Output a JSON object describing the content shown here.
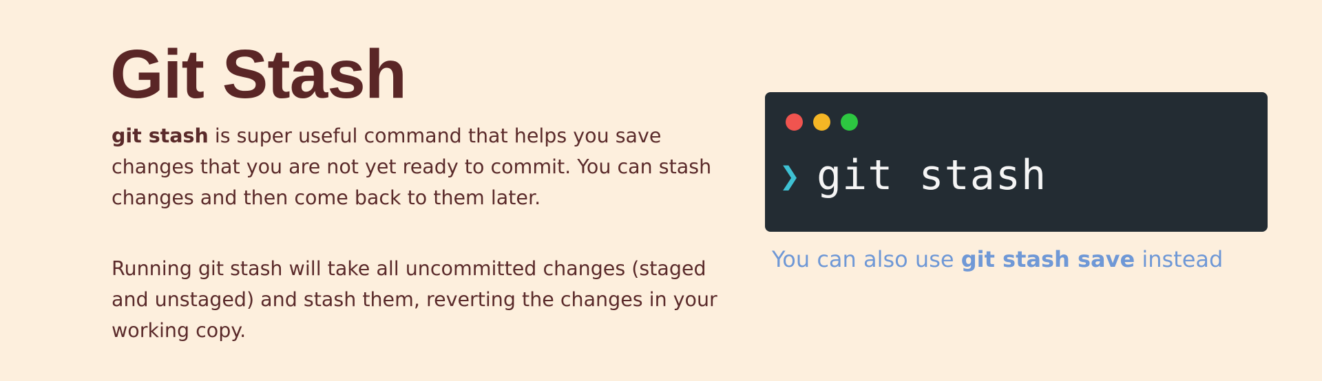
{
  "slide": {
    "title": "Git Stash",
    "paragraph1": {
      "bold": "git stash",
      "text": " is super useful command that helps you save changes that you are not yet ready to commit.  You can stash changes and then come back to them later."
    },
    "paragraph2": "Running git stash will take all uncommitted changes (staged and unstaged) and stash them, reverting the changes in your working copy.",
    "terminal": {
      "prompt_symbol": "❯",
      "command": "git stash"
    },
    "note": {
      "before": "You can also use ",
      "bold": "git stash save",
      "after": " instead"
    }
  },
  "colors": {
    "background": "#fdefdd",
    "title": "#5a2626",
    "body_text": "#5a2a2a",
    "terminal_bg": "#232c33",
    "prompt": "#3ec1d3",
    "note": "#6f98d6",
    "dot_red": "#f0544f",
    "dot_yellow": "#f5b625",
    "dot_green": "#2dc741"
  },
  "icons": [
    "close-dot-icon",
    "minimize-dot-icon",
    "maximize-dot-icon",
    "prompt-chevron-icon"
  ]
}
